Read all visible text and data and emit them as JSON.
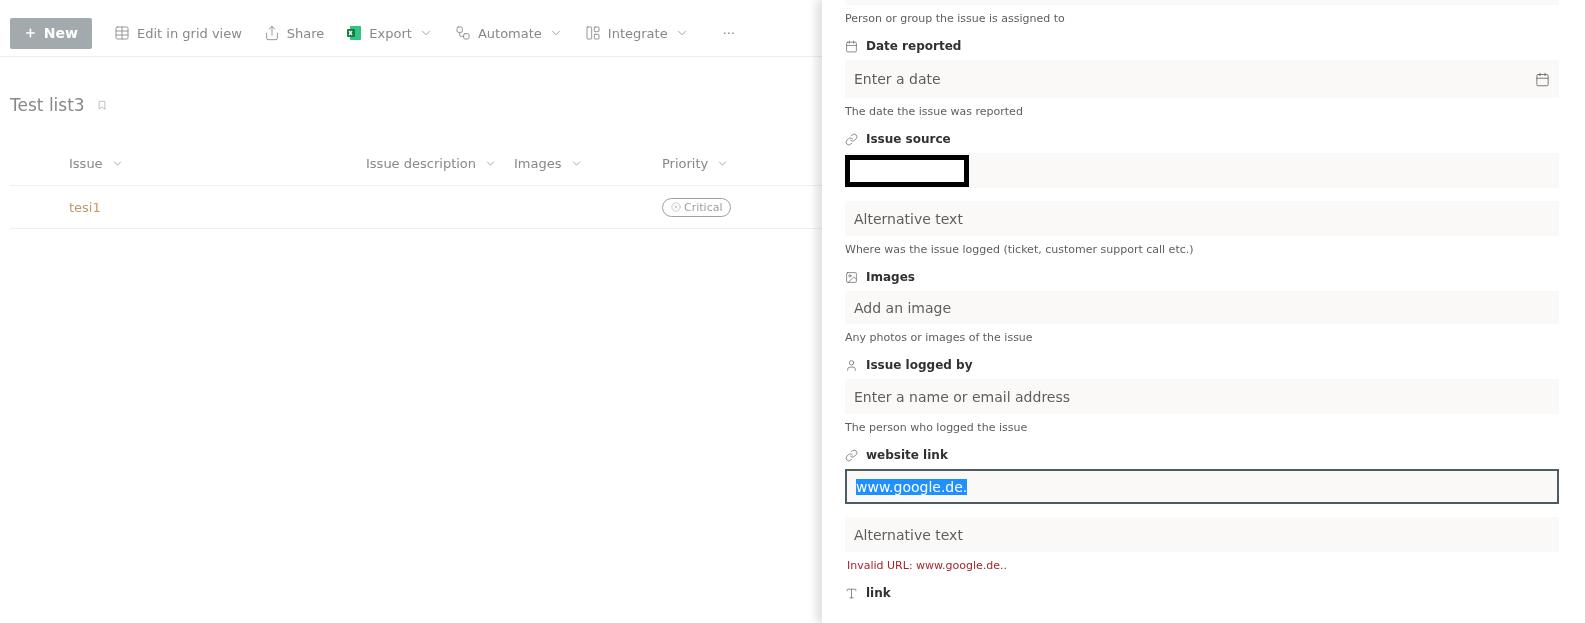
{
  "toolbar": {
    "new_button": "New",
    "items": [
      {
        "kind": "grid",
        "label": "Edit in grid view",
        "dropdown": false
      },
      {
        "kind": "share",
        "label": "Share",
        "dropdown": false
      },
      {
        "kind": "excel",
        "label": "Export",
        "dropdown": true
      },
      {
        "kind": "automate",
        "label": "Automate",
        "dropdown": true
      },
      {
        "kind": "integrate",
        "label": "Integrate",
        "dropdown": true
      }
    ],
    "more": "···"
  },
  "list": {
    "title": "Test list3",
    "columns": [
      {
        "label": "Issue"
      },
      {
        "label": "Issue description"
      },
      {
        "label": "Images"
      },
      {
        "label": "Priority"
      }
    ],
    "rows": [
      {
        "issue": "tesi1",
        "priority": "Critical"
      }
    ]
  },
  "panel": {
    "fields": [
      {
        "kind": "cut-off",
        "helper": "Person or group the issue is assigned to"
      },
      {
        "kind": "date",
        "label": "Date reported",
        "inputs": [
          {
            "placeholder": "Enter a date"
          }
        ],
        "helper": "The date the issue was reported"
      },
      {
        "kind": "link",
        "label": "Issue source",
        "inputs": [
          {
            "redacted": true
          },
          {
            "placeholder": "Alternative text"
          }
        ],
        "helper": "Where was the issue logged (ticket, customer support call etc.)"
      },
      {
        "kind": "image",
        "label": "Images",
        "inputs": [
          {
            "placeholder": "Add an image"
          }
        ],
        "helper": "Any photos or images of the issue"
      },
      {
        "kind": "person",
        "label": "Issue logged by",
        "inputs": [
          {
            "placeholder": "Enter a name or email address"
          }
        ],
        "helper": "The person who logged the issue"
      },
      {
        "kind": "link",
        "label": "website link",
        "inputs": [
          {
            "value": "www.google.de.",
            "focused": true
          },
          {
            "placeholder": "Alternative text"
          }
        ],
        "error": "Invalid URL: www.google.de.."
      },
      {
        "kind": "text",
        "label": "link"
      }
    ]
  }
}
